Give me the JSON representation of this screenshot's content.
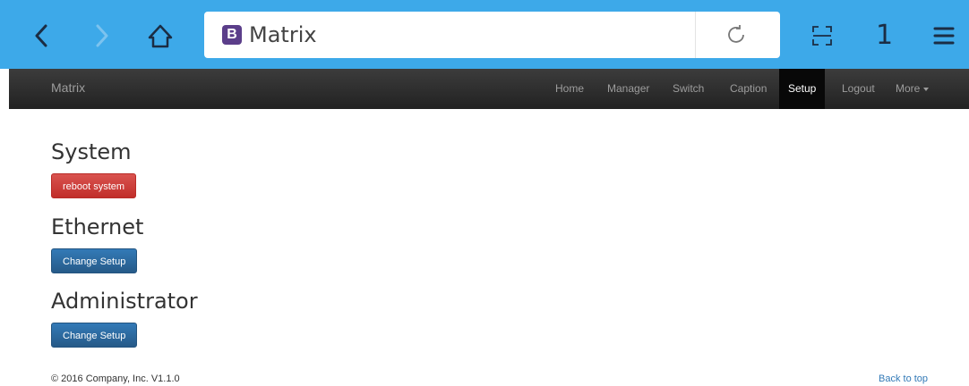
{
  "browser": {
    "url_title": "Matrix",
    "tab_count": "1",
    "logo_letter": "B",
    "accent": "#3da9e9",
    "icons": [
      "back-icon",
      "forward-icon",
      "home-icon",
      "reload-icon",
      "scan-icon",
      "menu-icon"
    ]
  },
  "navbar": {
    "brand": "Matrix",
    "items": [
      {
        "label": "Home"
      },
      {
        "label": "Manager"
      },
      {
        "label": "Switch"
      },
      {
        "label": "Caption"
      },
      {
        "label": "Setup",
        "active": true
      },
      {
        "label": "Logout"
      },
      {
        "label": "More"
      }
    ]
  },
  "sections": {
    "system": {
      "title": "System",
      "button": "reboot system"
    },
    "ethernet": {
      "title": "Ethernet",
      "button": "Change Setup"
    },
    "administrator": {
      "title": "Administrator",
      "button": "Change Setup"
    }
  },
  "footer": {
    "copyright": "© 2016 Company, Inc. V1.1.0",
    "back_to_top": "Back to top"
  },
  "colors": {
    "danger": "#d9534f",
    "primary": "#337ab7",
    "navbar": "#222222"
  }
}
